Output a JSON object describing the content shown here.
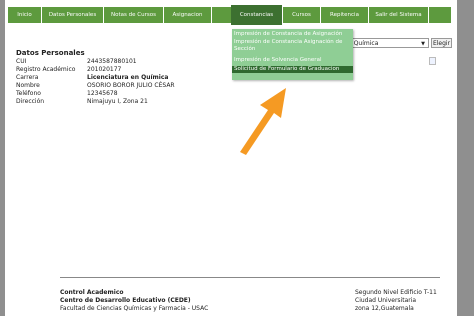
{
  "nav": {
    "tabs": [
      {
        "label": "Inicio"
      },
      {
        "label": "Datos Personales"
      },
      {
        "label": "Notas de Cursos"
      },
      {
        "label": "Asignacion"
      },
      {
        "label": "Constancias"
      },
      {
        "label": "Cursos"
      },
      {
        "label": "Repitencia"
      },
      {
        "label": "Salir del Sistema"
      }
    ]
  },
  "dropdown": {
    "items": [
      {
        "label": "Impresión de Constancia de Asignación"
      },
      {
        "label": "Impresión de Constancia Asignación de Sección"
      },
      {
        "label": "Impresión de Solvencia General"
      },
      {
        "label": "Solicitud de Formulario de Graduacion"
      }
    ]
  },
  "career_select": {
    "value": "n Química",
    "button": "Elegir"
  },
  "personal": {
    "title": "Datos Personales",
    "fields": [
      {
        "label": "CUI",
        "value": "2443587880101"
      },
      {
        "label": "Registro Académico",
        "value": "201020177"
      },
      {
        "label": "Carrera",
        "value": "Licenciatura en Química"
      },
      {
        "label": "Nombre",
        "value": "OSORIO BOROR JULIO CÉSAR"
      },
      {
        "label": "Teléfono",
        "value": "12345678"
      },
      {
        "label": "Dirección",
        "value": "Nimajuyu I, Zona 21"
      }
    ]
  },
  "footer": {
    "left": [
      "Control Academico",
      "Centro de Desarrollo Educativo (CEDE)",
      "Facultad de Ciencias Químicas y Farmacia - USAC"
    ],
    "right": [
      "Segundo Nivel Edificio T-11",
      "Ciudad Universitaria",
      "zona 12,Guatemala"
    ]
  },
  "colors": {
    "nav": "#5d9a3e",
    "dropdown": "#8fce95",
    "highlight": "#2f6a2f",
    "arrow": "#f59a23"
  }
}
